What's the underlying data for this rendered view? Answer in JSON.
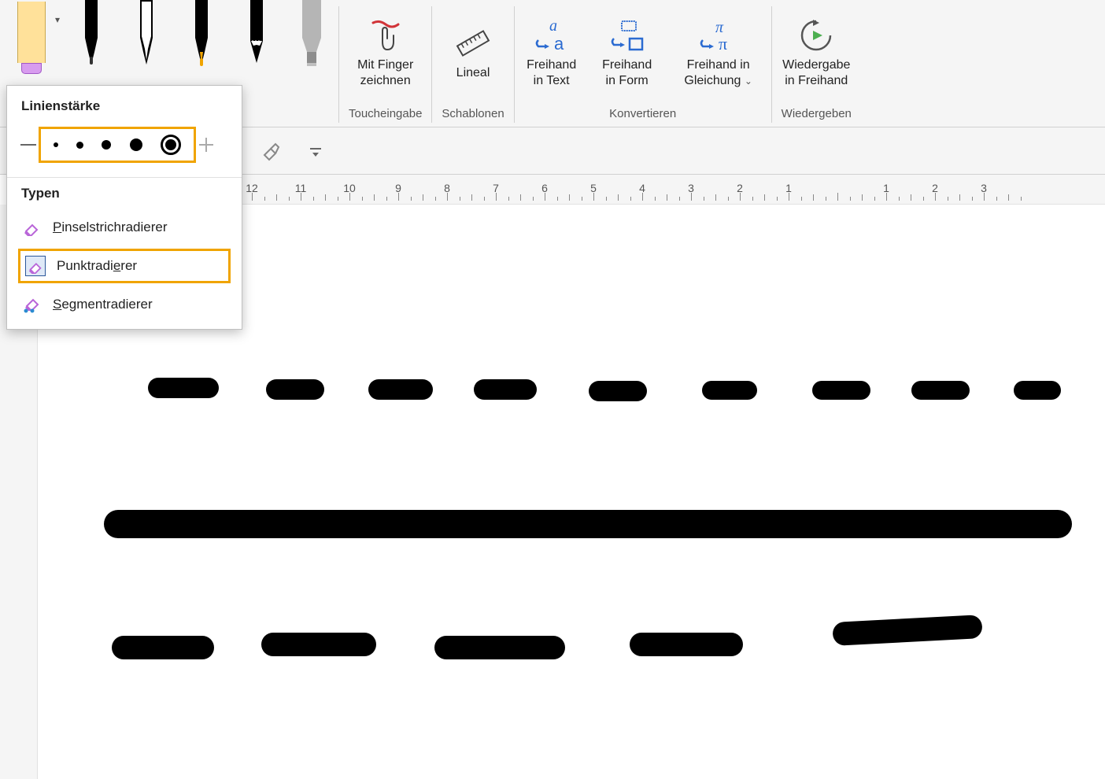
{
  "ribbon": {
    "touch_group": {
      "finger_draw": "Mit Finger\nzeichnen",
      "caption": "Toucheingabe"
    },
    "stencils_group": {
      "ruler": "Lineal",
      "caption": "Schablonen"
    },
    "convert_group": {
      "ink_to_text": "Freihand\nin Text",
      "ink_to_shape": "Freihand\nin Form",
      "ink_to_math": "Freihand in\nGleichung",
      "caption": "Konvertieren"
    },
    "replay_group": {
      "ink_replay": "Wiedergabe\nin Freihand",
      "caption": "Wiedergeben"
    }
  },
  "popup": {
    "thickness_title": "Linienstärke",
    "types_title": "Typen",
    "type_stroke": "Pinselstrichradierer",
    "type_point": "Punktradierer",
    "type_segment": "Segmentradierer",
    "type_stroke_underline_char": "P",
    "type_point_underline_char": "e",
    "type_segment_underline_char": "S"
  },
  "ruler_numbers": [
    "12",
    "11",
    "10",
    "9",
    "8",
    "7",
    "6",
    "5",
    "4",
    "3",
    "2",
    "1",
    "",
    "1",
    "2",
    "3"
  ],
  "colors": {
    "accent_orange": "#f0a400",
    "office_blue": "#2b6bd1"
  }
}
